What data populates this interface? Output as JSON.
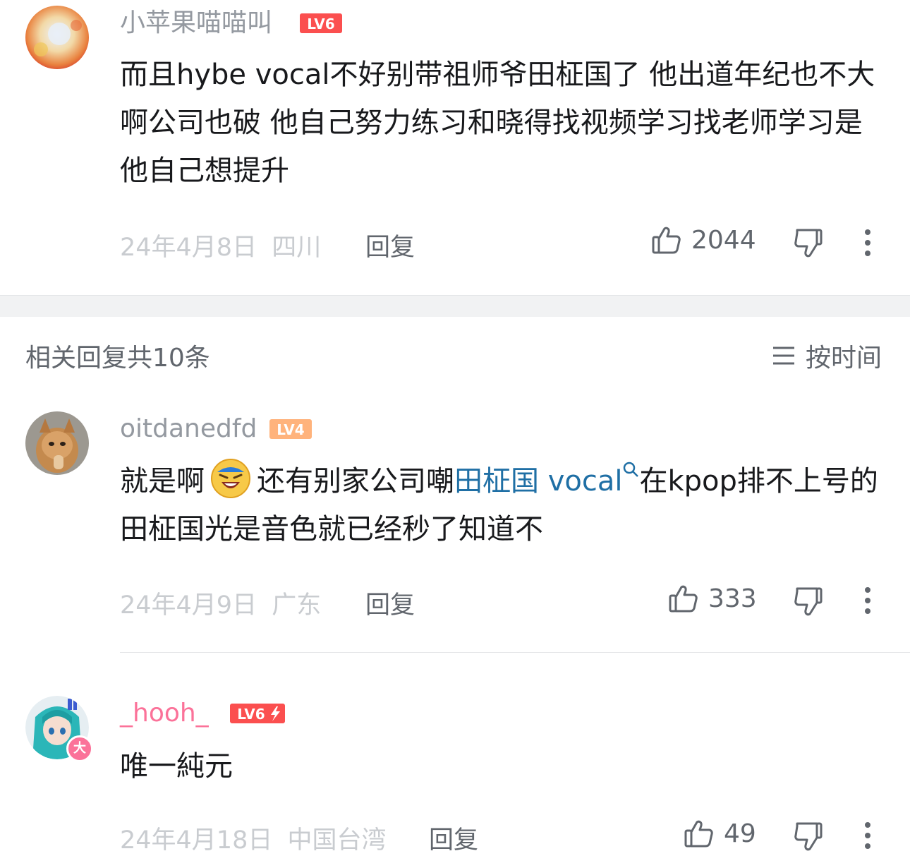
{
  "comments": [
    {
      "username": "小苹果喵喵叫",
      "level": "LV6",
      "text": "而且hybe vocal不好别带祖师爷田柾国了 他出道年纪也不大啊公司也破 他自己努力练习和晓得找视频学习找老师学习是他自己想提升",
      "date": "24年4月8日",
      "location": "四川",
      "reply_label": "回复",
      "likes": "2044"
    },
    {
      "username": "oitdanedfd",
      "level": "LV4",
      "text_before": "就是啊",
      "text_mid": "还有别家公司嘲",
      "link_text": "田柾国 vocal",
      "text_after": "在kpop排不上号的 田柾国光是音色就已经秒了知道不",
      "date": "24年4月9日",
      "location": "广东",
      "reply_label": "回复",
      "likes": "333"
    },
    {
      "username": "_hooh_",
      "level": "LV6",
      "avatar_badge": "大",
      "text": "唯一純元",
      "date": "24年4月18日",
      "location": "中国台湾",
      "reply_label": "回复",
      "likes": "49"
    }
  ],
  "replies_header": "相关回复共10条",
  "sort_label": "按时间",
  "colors": {
    "level6": "#fb4f4f",
    "level4": "#ffb37c",
    "username_gray": "#9499a0",
    "username_vip": "#fb7299",
    "link": "#1f6fa5"
  }
}
